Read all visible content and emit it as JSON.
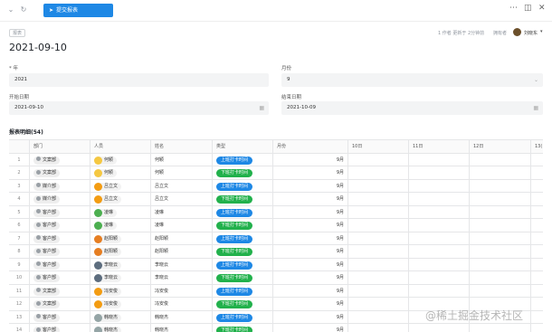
{
  "toolbar": {
    "collapse_icon": "chevron-down-icon",
    "refresh_icon": "refresh-icon",
    "submit_label": "提交报表",
    "more_icon": "more-dots-icon",
    "layout_icon": "panel-icon",
    "close_icon": "close-icon"
  },
  "header": {
    "breadcrumb": "报表",
    "meta_text": "1 作者 更新于 2分钟前",
    "owner_label": "拥有者",
    "owner_name": "刘晓东",
    "title": "2021-09-10"
  },
  "form": {
    "year_label": "年",
    "year_value": "2021",
    "month_label": "月份",
    "month_value": "9",
    "start_label": "开始日期",
    "start_value": "2021-09-10",
    "end_label": "结束日期",
    "end_value": "2021-10-09"
  },
  "details": {
    "title": "报表明细(54)",
    "columns": [
      "部门",
      "人员",
      "姓名",
      "类型",
      "月份",
      "10日",
      "11日",
      "12日",
      "13("
    ],
    "rows": [
      {
        "n": "1",
        "dept": "文案部",
        "person": "何颖",
        "name": "何颖",
        "type": "上班打卡时间",
        "month": "9月"
      },
      {
        "n": "2",
        "dept": "文案部",
        "person": "何颖",
        "name": "何颖",
        "type": "下班打卡时间",
        "month": "9月"
      },
      {
        "n": "3",
        "dept": "媒介部",
        "person": "吕立文",
        "name": "吕立文",
        "type": "上班打卡时间",
        "month": "9月"
      },
      {
        "n": "4",
        "dept": "媒介部",
        "person": "吕立文",
        "name": "吕立文",
        "type": "下班打卡时间",
        "month": "9月"
      },
      {
        "n": "5",
        "dept": "客户部",
        "person": "凌琳",
        "name": "凌琳",
        "type": "上班打卡时间",
        "month": "9月"
      },
      {
        "n": "6",
        "dept": "客户部",
        "person": "凌琳",
        "name": "凌琳",
        "type": "下班打卡时间",
        "month": "9月"
      },
      {
        "n": "7",
        "dept": "客户部",
        "person": "赵阳颖",
        "name": "赵阳颖",
        "type": "上班打卡时间",
        "month": "9月"
      },
      {
        "n": "8",
        "dept": "客户部",
        "person": "赵阳颖",
        "name": "赵阳颖",
        "type": "下班打卡时间",
        "month": "9月"
      },
      {
        "n": "9",
        "dept": "客户部",
        "person": "李晓云",
        "name": "李晓云",
        "type": "上班打卡时间",
        "month": "9月"
      },
      {
        "n": "10",
        "dept": "客户部",
        "person": "李晓云",
        "name": "李晓云",
        "type": "下班打卡时间",
        "month": "9月"
      },
      {
        "n": "11",
        "dept": "文案部",
        "person": "冯安俊",
        "name": "冯安俊",
        "type": "上班打卡时间",
        "month": "9月"
      },
      {
        "n": "12",
        "dept": "文案部",
        "person": "冯安俊",
        "name": "冯安俊",
        "type": "下班打卡时间",
        "month": "9月"
      },
      {
        "n": "13",
        "dept": "客户部",
        "person": "韩晓杰",
        "name": "韩晓杰",
        "type": "上班打卡时间",
        "month": "9月"
      },
      {
        "n": "14",
        "dept": "客户部",
        "person": "韩晓杰",
        "name": "韩晓杰",
        "type": "下班打卡时间",
        "month": "9月"
      }
    ]
  },
  "colors": {
    "accent": "#1e88e5",
    "clock_in": "#1e88e5",
    "clock_out": "#22b14c",
    "avatar_palette": [
      "#f5c842",
      "#f5c842",
      "#f39c12",
      "#f39c12",
      "#4caf50",
      "#4caf50",
      "#e67e22",
      "#e67e22",
      "#5d6d7e",
      "#5d6d7e",
      "#f39c12",
      "#f39c12",
      "#95a5a6",
      "#95a5a6"
    ]
  },
  "watermark": "@稀土掘金技术社区"
}
